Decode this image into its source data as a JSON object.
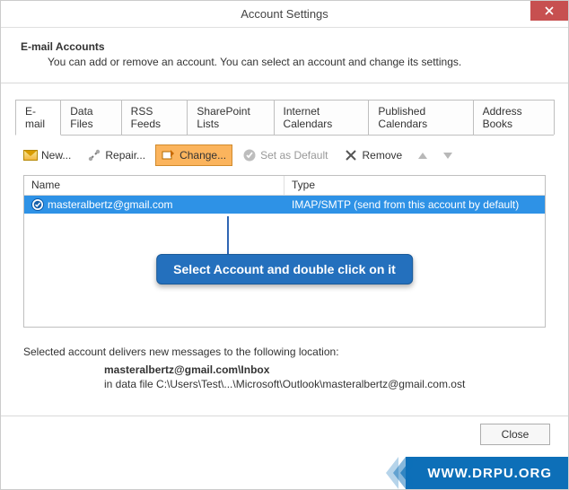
{
  "titlebar": {
    "title": "Account Settings"
  },
  "header": {
    "title": "E-mail Accounts",
    "desc": "You can add or remove an account. You can select an account and change its settings."
  },
  "tabs": [
    {
      "label": "E-mail",
      "active": true
    },
    {
      "label": "Data Files"
    },
    {
      "label": "RSS Feeds"
    },
    {
      "label": "SharePoint Lists"
    },
    {
      "label": "Internet Calendars"
    },
    {
      "label": "Published Calendars"
    },
    {
      "label": "Address Books"
    }
  ],
  "toolbar": {
    "new": "New...",
    "repair": "Repair...",
    "change": "Change...",
    "set_default": "Set as Default",
    "remove": "Remove"
  },
  "list": {
    "columns": {
      "name": "Name",
      "type": "Type"
    },
    "rows": [
      {
        "name": "masteralbertz@gmail.com",
        "type": "IMAP/SMTP (send from this account by default)",
        "selected": true
      }
    ]
  },
  "callout": "Select Account and double click on it",
  "location": {
    "label": "Selected account delivers new messages to the following location:",
    "path_bold": "masteralbertz@gmail.com\\Inbox",
    "path_line2": "in data file C:\\Users\\Test\\...\\Microsoft\\Outlook\\masteralbertz@gmail.com.ost"
  },
  "buttons": {
    "close": "Close"
  },
  "watermark": "WWW.DRPU.ORG"
}
